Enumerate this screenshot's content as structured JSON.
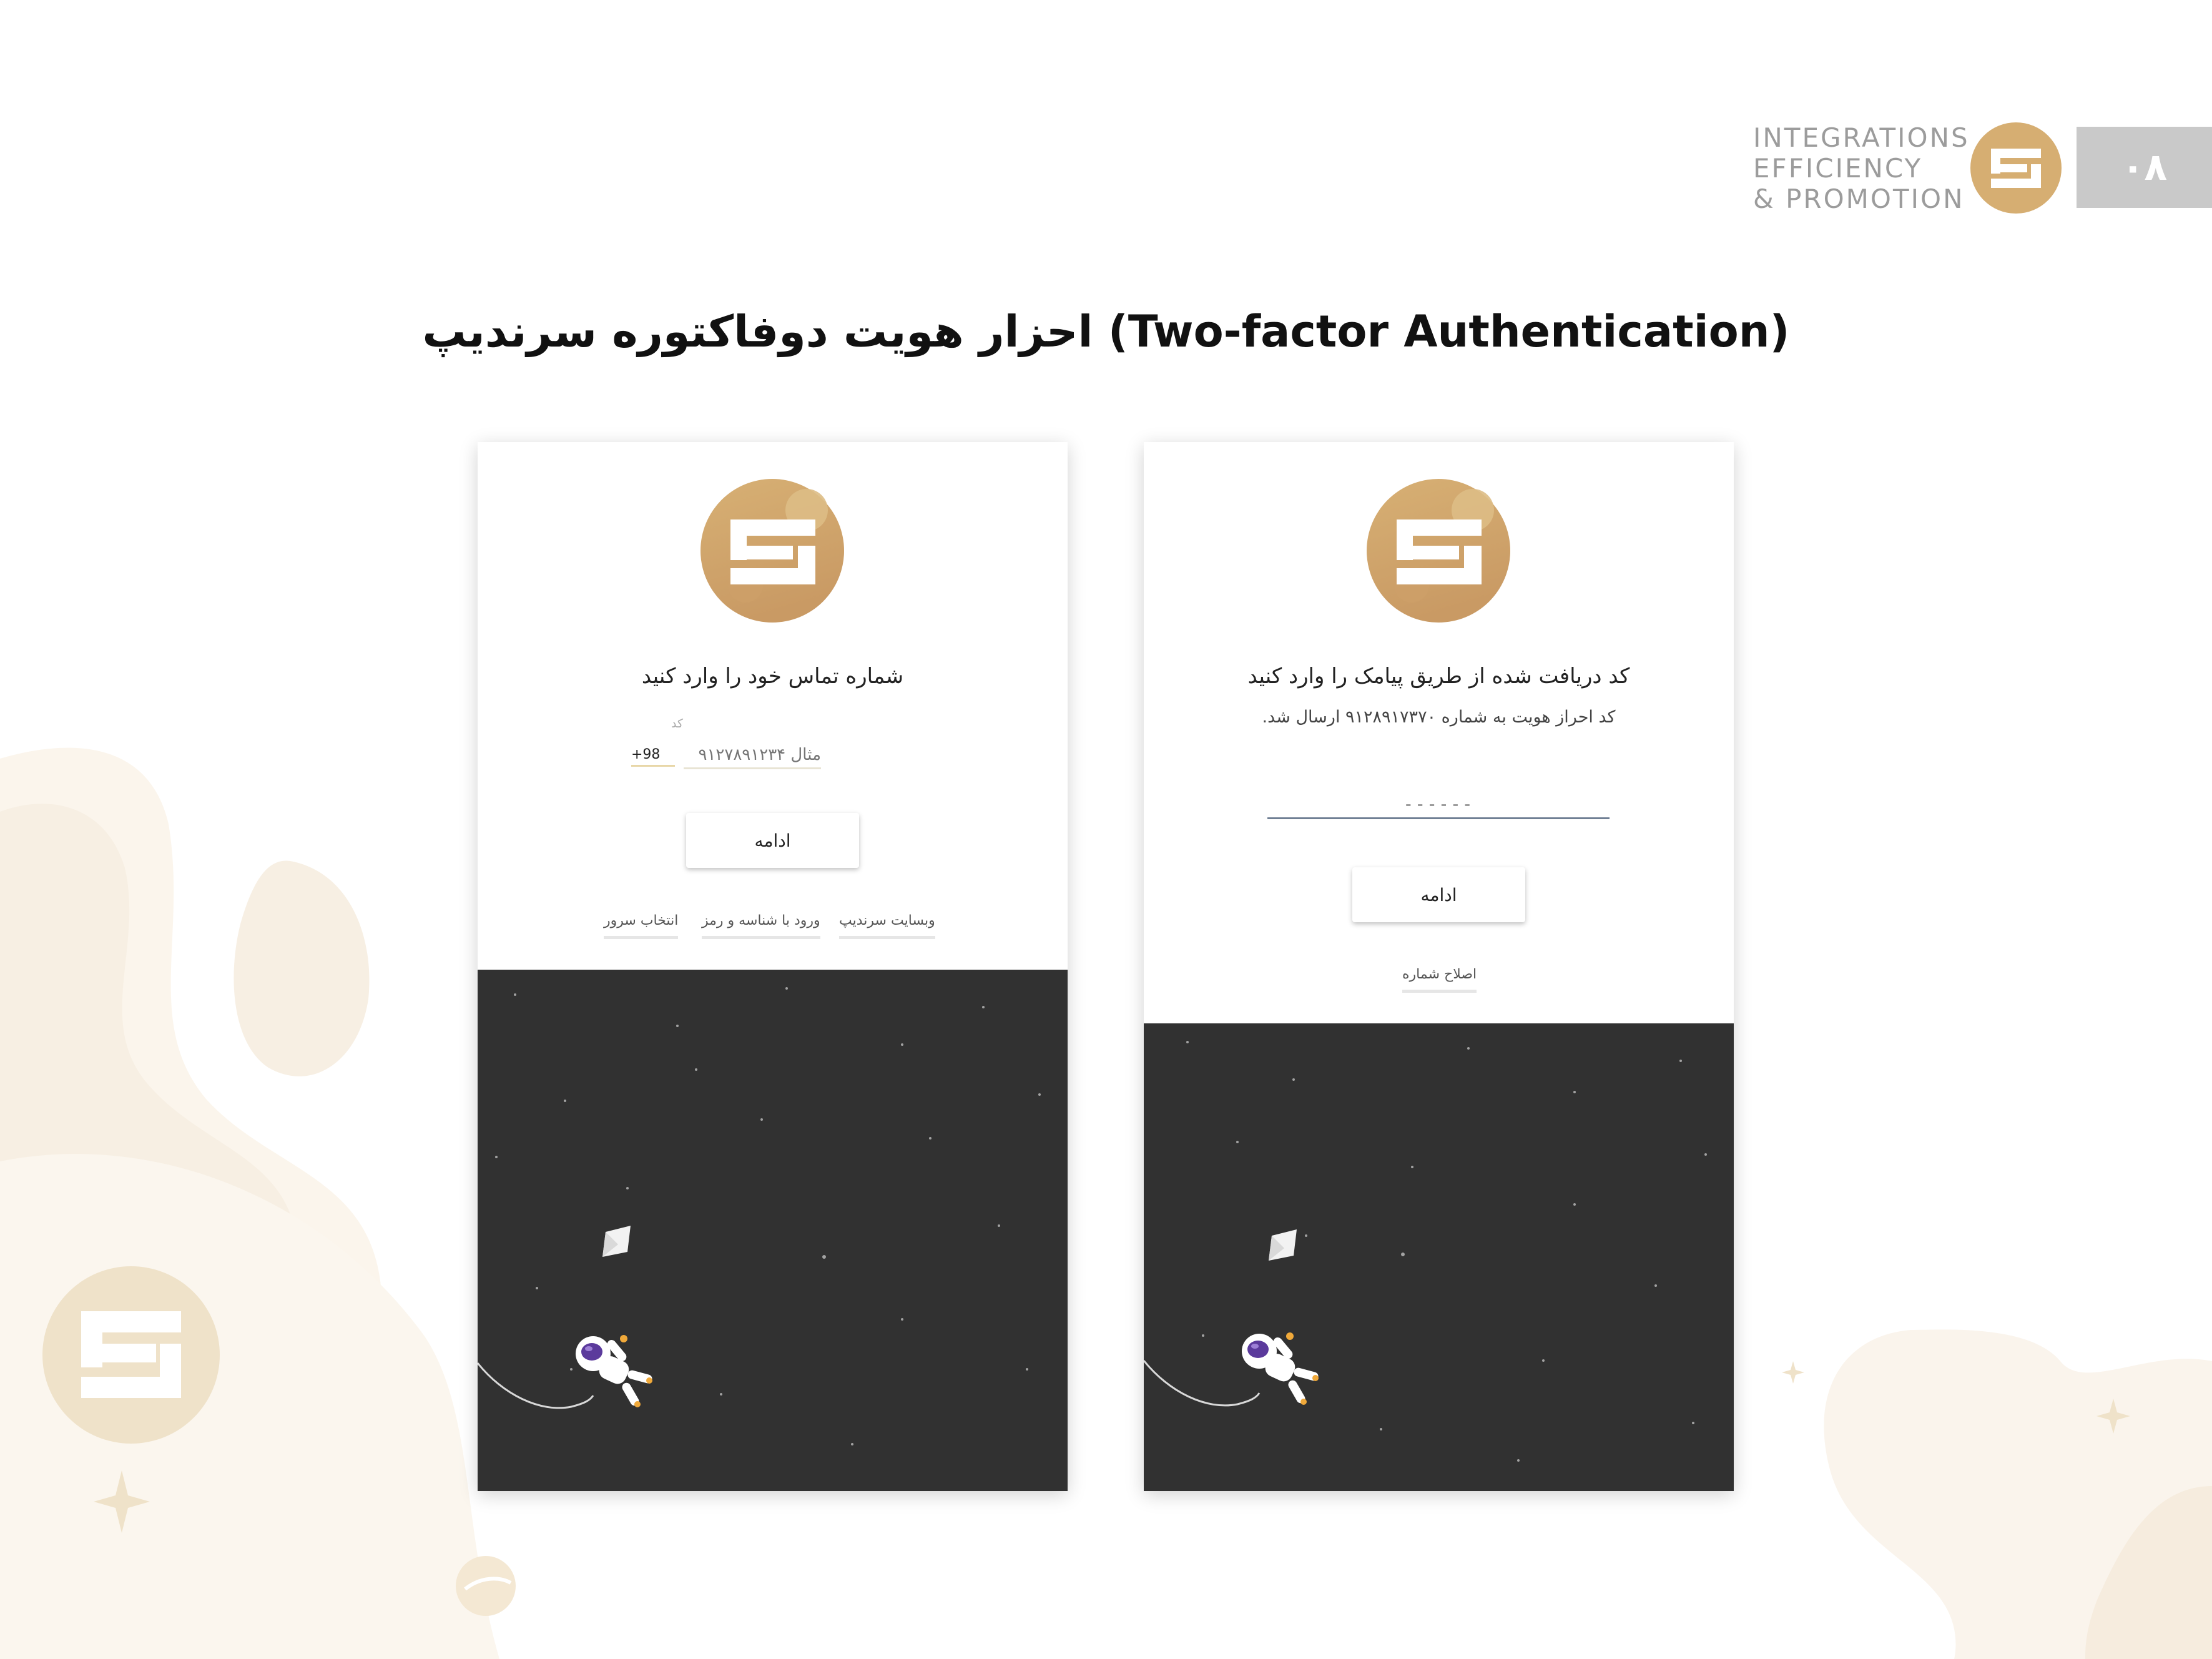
{
  "header": {
    "brand_lines": [
      "INTEGRATIONS",
      "EFFICIENCY",
      "& PROMOTION"
    ],
    "page_number": "۰۸"
  },
  "title": "احزار هویت دوفاکتوره سرندیپ (Two-factor Authentication)",
  "login_card": {
    "heading": "شماره تماس خود را وارد کنید",
    "code_label": "کد",
    "country_code": "+98",
    "phone_placeholder": "مثال ۹۱۲۷۸۹۱۲۳۴",
    "continue_label": "ادامه",
    "links": [
      "وبسایت سرندیپ",
      "ورود با شناسه و رمز",
      "انتخاب سرور"
    ]
  },
  "verify_card": {
    "heading": "کد دریافت شده از طریق پیامک را وارد کنید",
    "subtext": "کد احراز هویت به شماره ۹۱۲۸۹۱۷۳۷۰ ارسال شد.",
    "otp_placeholder": "------",
    "continue_label": "ادامه",
    "edit_link": "اصلاح شماره"
  },
  "colors": {
    "brand_gold": "#d6ae72",
    "brand_text_gray": "#9c9c9c",
    "page_number_bg": "#c9c9c9",
    "space_bg": "#313131",
    "background_cream": "#f7efe3"
  }
}
